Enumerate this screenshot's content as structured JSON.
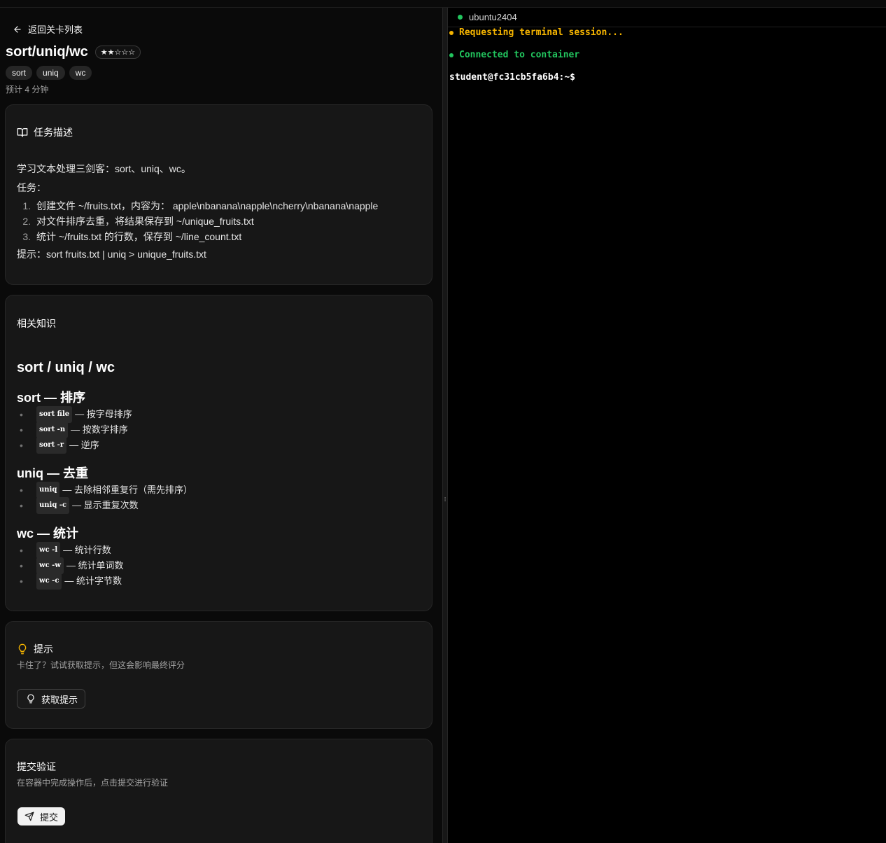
{
  "header": {
    "back_label": "返回关卡列表",
    "title": "sort/uniq/wc",
    "difficulty": "★★☆☆☆",
    "tags": [
      "sort",
      "uniq",
      "wc"
    ],
    "estimate": "预计 4 分钟"
  },
  "task": {
    "heading": "任务描述",
    "intro": "学习文本处理三剑客：sort、uniq、wc。",
    "label": "任务：",
    "steps": [
      {
        "num": "1.",
        "text": "创建文件 ~/fruits.txt，内容为： apple\\nbanana\\napple\\ncherry\\nbanana\\napple"
      },
      {
        "num": "2.",
        "text": "对文件排序去重，将结果保存到 ~/unique_fruits.txt"
      },
      {
        "num": "3.",
        "text": "统计 ~/fruits.txt 的行数，保存到 ~/line_count.txt"
      }
    ],
    "hint": "提示：sort fruits.txt | uniq > unique_fruits.txt"
  },
  "knowledge": {
    "heading": "相关知识",
    "h1": "sort / uniq / wc",
    "sections": [
      {
        "title": "sort — 排序",
        "items": [
          {
            "code": "sort file",
            "text": "— 按字母排序"
          },
          {
            "code": "sort -n",
            "text": "— 按数字排序"
          },
          {
            "code": "sort -r",
            "text": "— 逆序"
          }
        ]
      },
      {
        "title": "uniq — 去重",
        "items": [
          {
            "code": "uniq",
            "text": "— 去除相邻重复行（需先排序）"
          },
          {
            "code": "uniq -c",
            "text": "— 显示重复次数"
          }
        ]
      },
      {
        "title": "wc — 统计",
        "items": [
          {
            "code": "wc -l",
            "text": "— 统计行数"
          },
          {
            "code": "wc -w",
            "text": "— 统计单词数"
          },
          {
            "code": "wc -c",
            "text": "— 统计字节数"
          }
        ]
      }
    ]
  },
  "hints": {
    "heading": "提示",
    "sub": "卡住了？试试获取提示，但这会影响最终评分",
    "button": "获取提示"
  },
  "submit": {
    "heading": "提交验证",
    "sub": "在容器中完成操作后，点击提交进行验证",
    "button": "提交"
  },
  "terminal": {
    "tab": "ubuntu2404",
    "lines": [
      {
        "text": "Requesting terminal session...",
        "color": "#f5b400"
      },
      {
        "text": "Connected to container",
        "color": "#22c55e"
      }
    ],
    "prompt": "student@fc31cb5fa6b4:~$"
  },
  "colors": {
    "accent_green": "#22c55e",
    "accent_yellow": "#f5b400"
  }
}
